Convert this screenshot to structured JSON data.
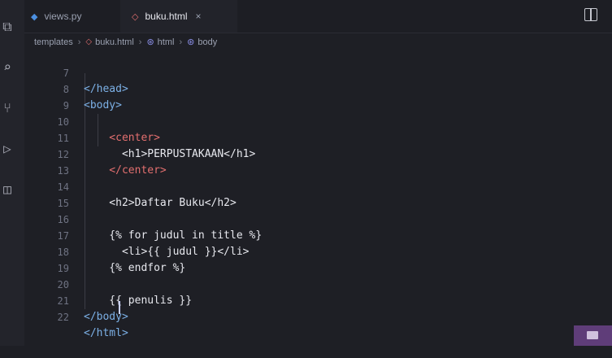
{
  "tabs": [
    {
      "label": "views.py",
      "icon": "python-file-icon"
    },
    {
      "label": "buku.html",
      "icon": "html-file-icon",
      "close": "×"
    }
  ],
  "breadcrumb": [
    "templates",
    "buku.html",
    "html",
    "body"
  ],
  "lines": [
    {
      "num": "7",
      "code": "</head>"
    },
    {
      "num": "8",
      "code": "<body>"
    },
    {
      "num": "9",
      "code": ""
    },
    {
      "num": "10",
      "code": "    <center>"
    },
    {
      "num": "11",
      "code": "      <h1>PERPUSTAKAAN</h1>"
    },
    {
      "num": "12",
      "code": "    </center>"
    },
    {
      "num": "13",
      "code": ""
    },
    {
      "num": "14",
      "code": "    <h2>Daftar Buku</h2>"
    },
    {
      "num": "15",
      "code": ""
    },
    {
      "num": "16",
      "code": "    {% for judul in title %}"
    },
    {
      "num": "17",
      "code": "      <li>{{ judul }}</li>"
    },
    {
      "num": "18",
      "code": "    {% endfor %}"
    },
    {
      "num": "19",
      "code": ""
    },
    {
      "num": "20",
      "code": "    {{ penulis }}"
    },
    {
      "num": "21",
      "code": "</body>"
    },
    {
      "num": "22",
      "code": "</html>"
    }
  ],
  "colors": {
    "background": "#1e1f25",
    "tag": "#e36f6f",
    "bracket": "#7cb0e6",
    "text": "#e7e8ee",
    "line_number": "#6f7383",
    "accent": "#5f3d79"
  }
}
